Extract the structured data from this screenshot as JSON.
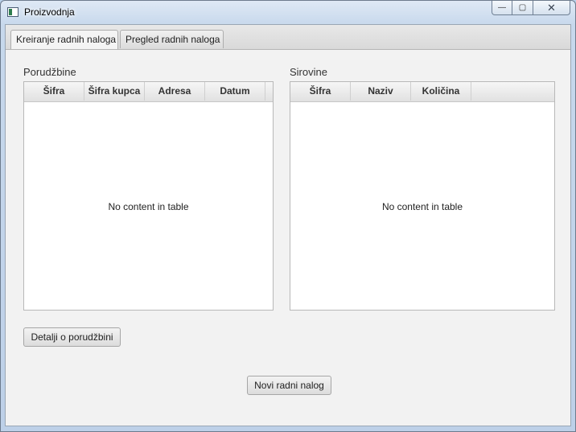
{
  "window": {
    "title": "Proizvodnja",
    "icon": "app-window-icon",
    "controls": {
      "minimize": "—",
      "maximize": "▢",
      "close": "✕"
    }
  },
  "tabs": [
    {
      "label": "Kreiranje radnih naloga",
      "active": true
    },
    {
      "label": "Pregled radnih naloga",
      "active": false
    }
  ],
  "orders": {
    "label": "Porudžbine",
    "columns": [
      "Šifra",
      "Šifra kupca",
      "Adresa",
      "Datum"
    ],
    "empty_text": "No content in table"
  },
  "materials": {
    "label": "Sirovine",
    "columns": [
      "Šifra",
      "Naziv",
      "Količina"
    ],
    "empty_text": "No content in table"
  },
  "buttons": {
    "order_details": "Detalji o porudžbini",
    "new_work_order": "Novi radni nalog"
  }
}
